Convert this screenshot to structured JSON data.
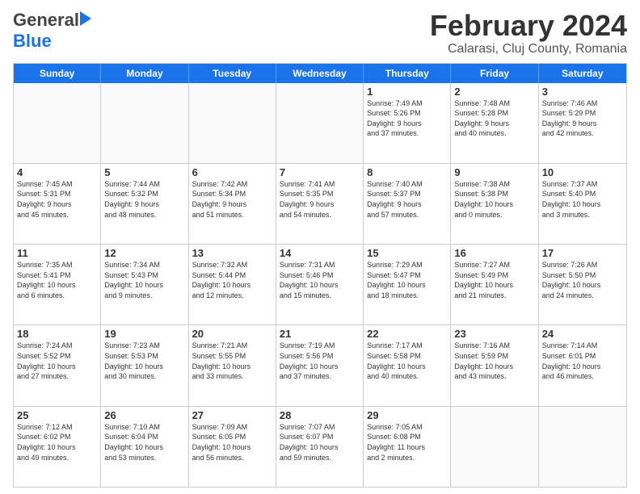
{
  "header": {
    "logo_general": "General",
    "logo_blue": "Blue",
    "month": "February 2024",
    "location": "Calarasi, Cluj County, Romania"
  },
  "weekdays": [
    "Sunday",
    "Monday",
    "Tuesday",
    "Wednesday",
    "Thursday",
    "Friday",
    "Saturday"
  ],
  "rows": [
    [
      {
        "day": "",
        "text": ""
      },
      {
        "day": "",
        "text": ""
      },
      {
        "day": "",
        "text": ""
      },
      {
        "day": "",
        "text": ""
      },
      {
        "day": "1",
        "text": "Sunrise: 7:49 AM\nSunset: 5:26 PM\nDaylight: 9 hours\nand 37 minutes."
      },
      {
        "day": "2",
        "text": "Sunrise: 7:48 AM\nSunset: 5:28 PM\nDaylight: 9 hours\nand 40 minutes."
      },
      {
        "day": "3",
        "text": "Sunrise: 7:46 AM\nSunset: 5:29 PM\nDaylight: 9 hours\nand 42 minutes."
      }
    ],
    [
      {
        "day": "4",
        "text": "Sunrise: 7:45 AM\nSunset: 5:31 PM\nDaylight: 9 hours\nand 45 minutes."
      },
      {
        "day": "5",
        "text": "Sunrise: 7:44 AM\nSunset: 5:32 PM\nDaylight: 9 hours\nand 48 minutes."
      },
      {
        "day": "6",
        "text": "Sunrise: 7:42 AM\nSunset: 5:34 PM\nDaylight: 9 hours\nand 51 minutes."
      },
      {
        "day": "7",
        "text": "Sunrise: 7:41 AM\nSunset: 5:35 PM\nDaylight: 9 hours\nand 54 minutes."
      },
      {
        "day": "8",
        "text": "Sunrise: 7:40 AM\nSunset: 5:37 PM\nDaylight: 9 hours\nand 57 minutes."
      },
      {
        "day": "9",
        "text": "Sunrise: 7:38 AM\nSunset: 5:38 PM\nDaylight: 10 hours\nand 0 minutes."
      },
      {
        "day": "10",
        "text": "Sunrise: 7:37 AM\nSunset: 5:40 PM\nDaylight: 10 hours\nand 3 minutes."
      }
    ],
    [
      {
        "day": "11",
        "text": "Sunrise: 7:35 AM\nSunset: 5:41 PM\nDaylight: 10 hours\nand 6 minutes."
      },
      {
        "day": "12",
        "text": "Sunrise: 7:34 AM\nSunset: 5:43 PM\nDaylight: 10 hours\nand 9 minutes."
      },
      {
        "day": "13",
        "text": "Sunrise: 7:32 AM\nSunset: 5:44 PM\nDaylight: 10 hours\nand 12 minutes."
      },
      {
        "day": "14",
        "text": "Sunrise: 7:31 AM\nSunset: 5:46 PM\nDaylight: 10 hours\nand 15 minutes."
      },
      {
        "day": "15",
        "text": "Sunrise: 7:29 AM\nSunset: 5:47 PM\nDaylight: 10 hours\nand 18 minutes."
      },
      {
        "day": "16",
        "text": "Sunrise: 7:27 AM\nSunset: 5:49 PM\nDaylight: 10 hours\nand 21 minutes."
      },
      {
        "day": "17",
        "text": "Sunrise: 7:26 AM\nSunset: 5:50 PM\nDaylight: 10 hours\nand 24 minutes."
      }
    ],
    [
      {
        "day": "18",
        "text": "Sunrise: 7:24 AM\nSunset: 5:52 PM\nDaylight: 10 hours\nand 27 minutes."
      },
      {
        "day": "19",
        "text": "Sunrise: 7:23 AM\nSunset: 5:53 PM\nDaylight: 10 hours\nand 30 minutes."
      },
      {
        "day": "20",
        "text": "Sunrise: 7:21 AM\nSunset: 5:55 PM\nDaylight: 10 hours\nand 33 minutes."
      },
      {
        "day": "21",
        "text": "Sunrise: 7:19 AM\nSunset: 5:56 PM\nDaylight: 10 hours\nand 37 minutes."
      },
      {
        "day": "22",
        "text": "Sunrise: 7:17 AM\nSunset: 5:58 PM\nDaylight: 10 hours\nand 40 minutes."
      },
      {
        "day": "23",
        "text": "Sunrise: 7:16 AM\nSunset: 5:59 PM\nDaylight: 10 hours\nand 43 minutes."
      },
      {
        "day": "24",
        "text": "Sunrise: 7:14 AM\nSunset: 6:01 PM\nDaylight: 10 hours\nand 46 minutes."
      }
    ],
    [
      {
        "day": "25",
        "text": "Sunrise: 7:12 AM\nSunset: 6:02 PM\nDaylight: 10 hours\nand 49 minutes."
      },
      {
        "day": "26",
        "text": "Sunrise: 7:10 AM\nSunset: 6:04 PM\nDaylight: 10 hours\nand 53 minutes."
      },
      {
        "day": "27",
        "text": "Sunrise: 7:09 AM\nSunset: 6:05 PM\nDaylight: 10 hours\nand 56 minutes."
      },
      {
        "day": "28",
        "text": "Sunrise: 7:07 AM\nSunset: 6:07 PM\nDaylight: 10 hours\nand 59 minutes."
      },
      {
        "day": "29",
        "text": "Sunrise: 7:05 AM\nSunset: 6:08 PM\nDaylight: 11 hours\nand 2 minutes."
      },
      {
        "day": "",
        "text": ""
      },
      {
        "day": "",
        "text": ""
      }
    ]
  ]
}
